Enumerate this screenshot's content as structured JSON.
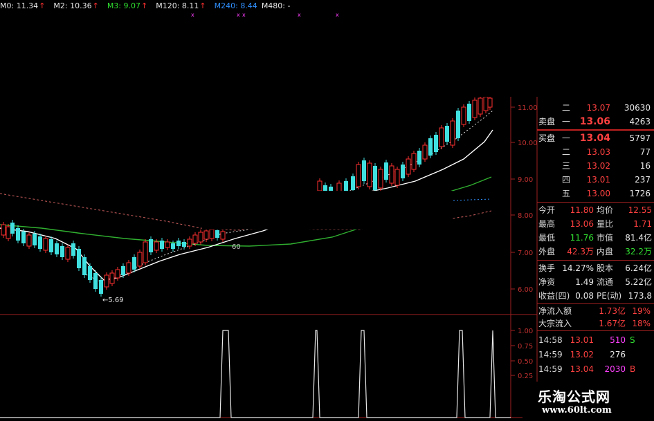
{
  "ma_legend": [
    {
      "label": "M0: 11.34",
      "color": "#e8e8e8"
    },
    {
      "label": "M2: 10.36",
      "color": "#e8e8e8"
    },
    {
      "label": "M3: 9.07",
      "color": "#30e030"
    },
    {
      "label": "M120: 8.11",
      "color": "#e8e8e8"
    },
    {
      "label": "M240: 8.44",
      "color": "#3090ff"
    },
    {
      "label": "M480: -",
      "color": "#e8e8e8"
    }
  ],
  "chart_data": {
    "type": "candlestick",
    "y_ticks": [
      "11.00",
      "10.00",
      "9.00",
      "8.00",
      "7.00",
      "6.00"
    ],
    "annotation_low": "5.69",
    "annotation_mid": "60",
    "lower_ticks": [
      "1.00",
      "0.75",
      "0.50",
      "0.25"
    ]
  },
  "quote": {
    "asks": [
      {
        "label": "二",
        "price": "13.07",
        "vol": "30630"
      },
      {
        "label": "一",
        "price": "13.06",
        "vol": "4263"
      }
    ],
    "sell_label": "卖盘",
    "buy_label": "买盘",
    "bids": [
      {
        "label": "一",
        "price": "13.04",
        "vol": "5797"
      },
      {
        "label": "二",
        "price": "13.03",
        "vol": "77"
      },
      {
        "label": "三",
        "price": "13.02",
        "vol": "16"
      },
      {
        "label": "四",
        "price": "13.01",
        "vol": "237"
      },
      {
        "label": "五",
        "price": "13.00",
        "vol": "1726"
      }
    ],
    "stats": [
      {
        "l1": "今开",
        "v1": "11.80",
        "c1": "red",
        "l2": "均价",
        "v2": "12.55",
        "c2": "red"
      },
      {
        "l1": "最高",
        "v1": "13.06",
        "c1": "red",
        "l2": "量比",
        "v2": "1.71",
        "c2": "red"
      },
      {
        "l1": "最低",
        "v1": "11.76",
        "c1": "grn",
        "l2": "市值",
        "v2": "81.4亿",
        "c2": "wht"
      },
      {
        "l1": "外盘",
        "v1": "42.3万",
        "c1": "red",
        "l2": "内盘",
        "v2": "32.2万",
        "c2": "grn"
      }
    ],
    "stats2": [
      {
        "l1": "换手",
        "v1": "14.27%",
        "c1": "wht",
        "l2": "股本",
        "v2": "6.24亿",
        "c2": "wht"
      },
      {
        "l1": "净资",
        "v1": "1.49",
        "c1": "wht",
        "l2": "流通",
        "v2": "5.22亿",
        "c2": "wht"
      },
      {
        "l1": "收益(四)",
        "v1": "0.08",
        "c1": "wht",
        "l2": "PE(动)",
        "v2": "173.8",
        "c2": "wht"
      }
    ],
    "flows": [
      {
        "label": "净流入额",
        "value": "1.73亿",
        "pct": "19%"
      },
      {
        "label": "大宗流入",
        "value": "1.67亿",
        "pct": "18%"
      }
    ],
    "ticks": [
      {
        "time": "14:58",
        "price": "13.01",
        "vol": "510",
        "flag": "S",
        "vcolor": "mag",
        "fcolor": "grn"
      },
      {
        "time": "14:59",
        "price": "13.02",
        "vol": "276",
        "flag": "",
        "vcolor": "wht",
        "fcolor": "wht"
      },
      {
        "time": "14:59",
        "price": "13.04",
        "vol": "2030",
        "flag": "B",
        "vcolor": "mag",
        "fcolor": "red"
      }
    ]
  },
  "watermark": {
    "title": "乐淘公式网",
    "url": "www.60lt.com"
  }
}
